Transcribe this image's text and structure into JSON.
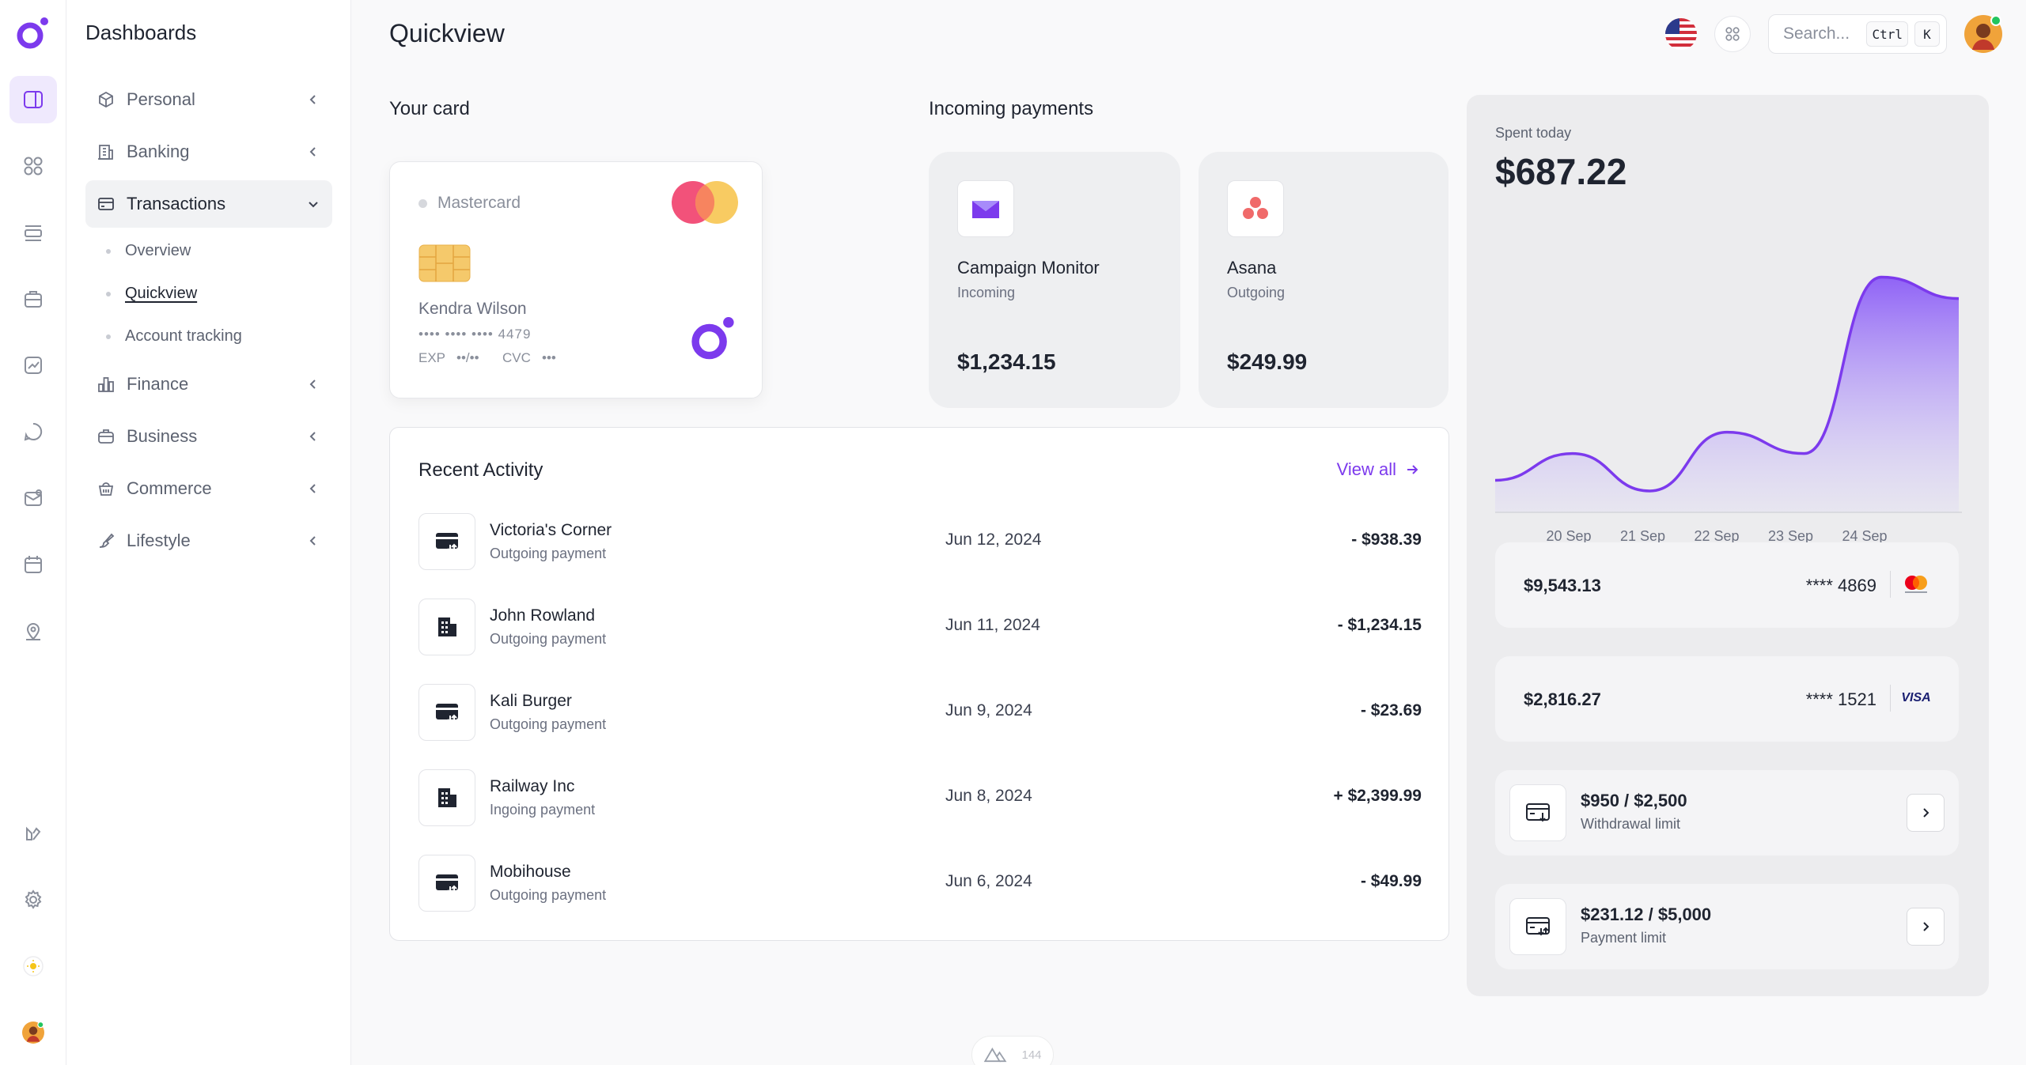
{
  "sidebar": {
    "title": "Dashboards",
    "items": [
      {
        "label": "Personal"
      },
      {
        "label": "Banking"
      },
      {
        "label": "Transactions"
      },
      {
        "label": "Finance"
      },
      {
        "label": "Business"
      },
      {
        "label": "Commerce"
      },
      {
        "label": "Lifestyle"
      }
    ],
    "subitems": [
      {
        "label": "Overview"
      },
      {
        "label": "Quickview"
      },
      {
        "label": "Account tracking"
      }
    ]
  },
  "header": {
    "title": "Quickview",
    "search_placeholder": "Search...",
    "kbd_ctrl": "Ctrl",
    "kbd_k": "K"
  },
  "card_section": {
    "title": "Your card",
    "brand": "Mastercard",
    "holder": "Kendra Wilson",
    "number": "•••• •••• •••• 4479",
    "exp_label": "EXP",
    "exp_value": "••/••",
    "cvc_label": "CVC",
    "cvc_value": "•••"
  },
  "incoming": {
    "title": "Incoming payments",
    "items": [
      {
        "name": "Campaign Monitor",
        "type": "Incoming",
        "amount": "$1,234.15"
      },
      {
        "name": "Asana",
        "type": "Outgoing",
        "amount": "$249.99"
      }
    ]
  },
  "activity": {
    "title": "Recent Activity",
    "view_all": "View all",
    "rows": [
      {
        "name": "Victoria's Corner",
        "sub": "Outgoing payment",
        "date": "Jun 12, 2024",
        "amount": "- $938.39",
        "icon": "card-transfer-icon"
      },
      {
        "name": "John Rowland",
        "sub": "Outgoing payment",
        "date": "Jun 11, 2024",
        "amount": "- $1,234.15",
        "icon": "building-icon"
      },
      {
        "name": "Kali Burger",
        "sub": "Outgoing payment",
        "date": "Jun 9, 2024",
        "amount": "- $23.69",
        "icon": "card-transfer-icon"
      },
      {
        "name": "Railway Inc",
        "sub": "Ingoing payment",
        "date": "Jun 8, 2024",
        "amount": "+ $2,399.99",
        "icon": "building-icon"
      },
      {
        "name": "Mobihouse",
        "sub": "Outgoing payment",
        "date": "Jun 6, 2024",
        "amount": "- $49.99",
        "icon": "card-transfer-icon"
      }
    ]
  },
  "spent": {
    "label": "Spent today",
    "value": "$687.22"
  },
  "chart_data": {
    "type": "area",
    "title": "",
    "xlabel": "",
    "ylabel": "",
    "categories": [
      "20 Sep",
      "21 Sep",
      "22 Sep",
      "23 Sep",
      "24 Sep"
    ],
    "x": [
      0,
      1,
      2,
      3,
      4,
      5,
      6,
      7,
      8,
      9,
      10,
      11,
      12
    ],
    "values": [
      12,
      22,
      8,
      30,
      22,
      88,
      80
    ],
    "point_x": [
      0,
      1,
      2,
      3,
      4,
      5,
      6
    ],
    "series": [
      {
        "values": [
          12,
          22,
          8,
          30,
          22,
          88,
          80
        ]
      }
    ],
    "ylim": [
      0,
      100
    ],
    "grid": false,
    "accent": "#7c3aed"
  },
  "accounts": [
    {
      "balance": "$9,543.13",
      "number": "**** 4869",
      "brand": "mastercard"
    },
    {
      "balance": "$2,816.27",
      "number": "**** 1521",
      "brand": "VISA"
    }
  ],
  "limits": [
    {
      "value": "$950 / $2,500",
      "label": "Withdrawal limit"
    },
    {
      "value": "$231.12 / $5,000",
      "label": "Payment limit"
    }
  ],
  "footer": {
    "count": "144"
  },
  "colors": {
    "accent": "#7c3aed",
    "mastercard_red": "#f2527a",
    "mastercard_yellow": "#f8c85a"
  }
}
